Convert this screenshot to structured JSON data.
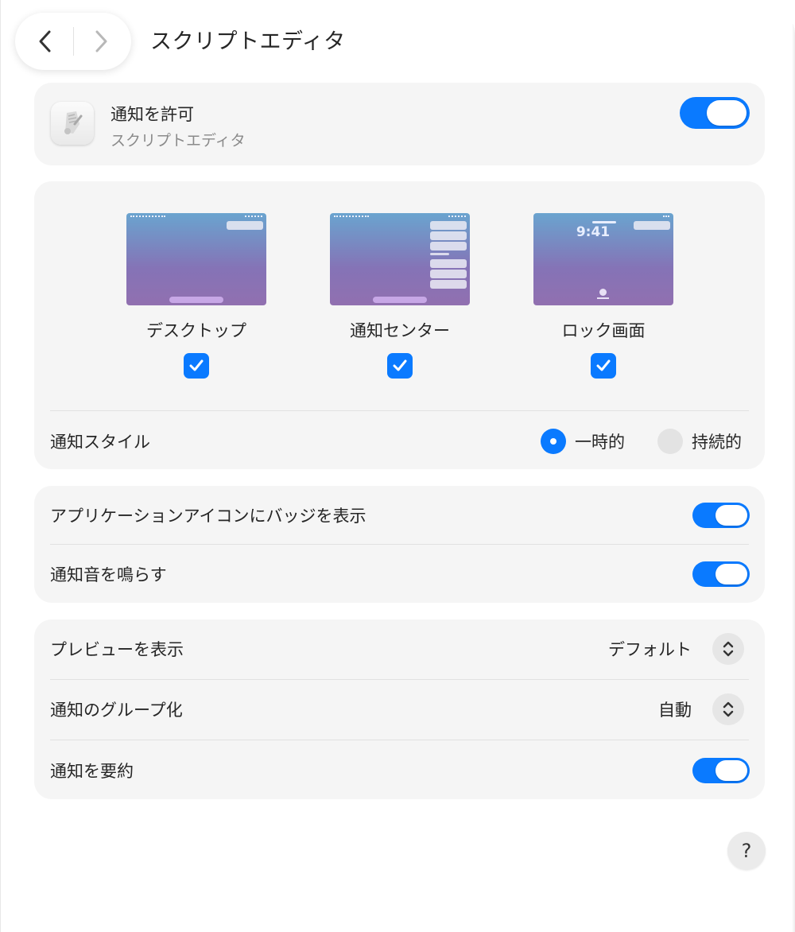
{
  "header": {
    "title": "スクリプトエディタ",
    "back_icon": "chevron-left-icon",
    "forward_icon": "chevron-right-icon"
  },
  "app": {
    "allow_label": "通知を許可",
    "app_name": "スクリプトエディタ",
    "allow_enabled": true
  },
  "alert_styles": {
    "options": [
      {
        "label": "デスクトップ",
        "checked": true
      },
      {
        "label": "通知センター",
        "checked": true
      },
      {
        "label": "ロック画面",
        "checked": true,
        "time": "9:41"
      }
    ],
    "style_label": "通知スタイル",
    "style_options": [
      {
        "label": "一時的",
        "selected": true
      },
      {
        "label": "持続的",
        "selected": false
      }
    ]
  },
  "badges": {
    "badge_label": "アプリケーションアイコンにバッジを表示",
    "badge_enabled": true,
    "sound_label": "通知音を鳴らす",
    "sound_enabled": true
  },
  "preview": {
    "show_preview_label": "プレビューを表示",
    "show_preview_value": "デフォルト",
    "grouping_label": "通知のグループ化",
    "grouping_value": "自動",
    "summarize_label": "通知を要約",
    "summarize_enabled": true
  },
  "help": {
    "label": "?"
  },
  "colors": {
    "accent": "#0a7aff",
    "card_bg": "#f5f5f5"
  }
}
